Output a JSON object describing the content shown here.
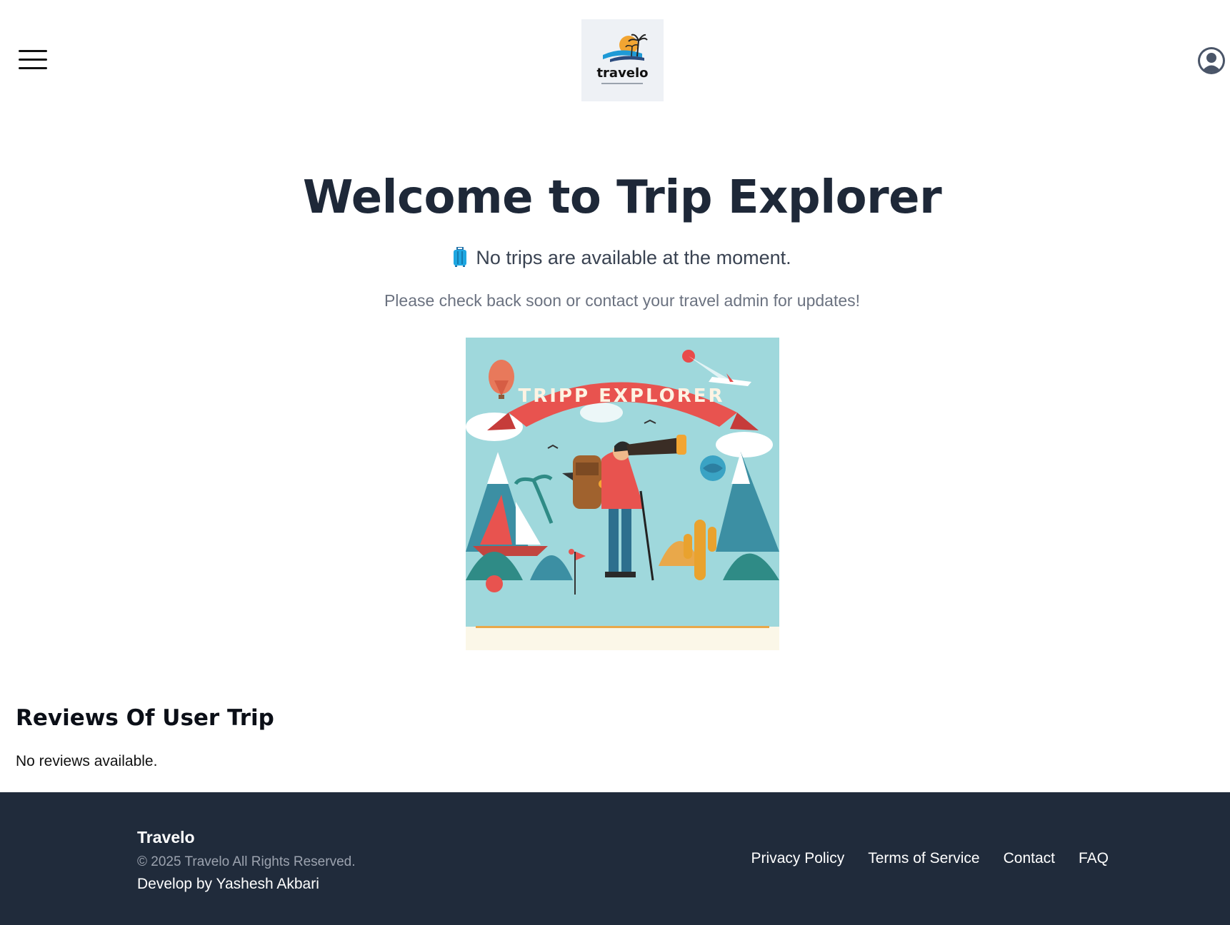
{
  "header": {
    "logo_text": "travelo",
    "menu_icon": "hamburger-menu-icon",
    "profile_icon": "user-profile-icon"
  },
  "hero": {
    "title": "Welcome to Trip Explorer",
    "no_trips_icon": "suitcase-icon",
    "no_trips_text": "No trips are available at the moment.",
    "subtitle": "Please check back soon or contact your travel admin for updates!",
    "image_banner_text": "TRIPP EXPLORER"
  },
  "reviews": {
    "title": "Reviews Of User Trip",
    "empty_text": "No reviews available."
  },
  "footer": {
    "brand": "Travelo",
    "copyright": "© 2025 Travelo All Rights Reserved.",
    "developer": "Develop by Yashesh Akbari",
    "links": [
      "Privacy Policy",
      "Terms of Service",
      "Contact",
      "FAQ"
    ]
  },
  "colors": {
    "title": "#1e2838",
    "footer_bg": "#202b3b",
    "accent_suitcase": "#1ea7e1"
  }
}
